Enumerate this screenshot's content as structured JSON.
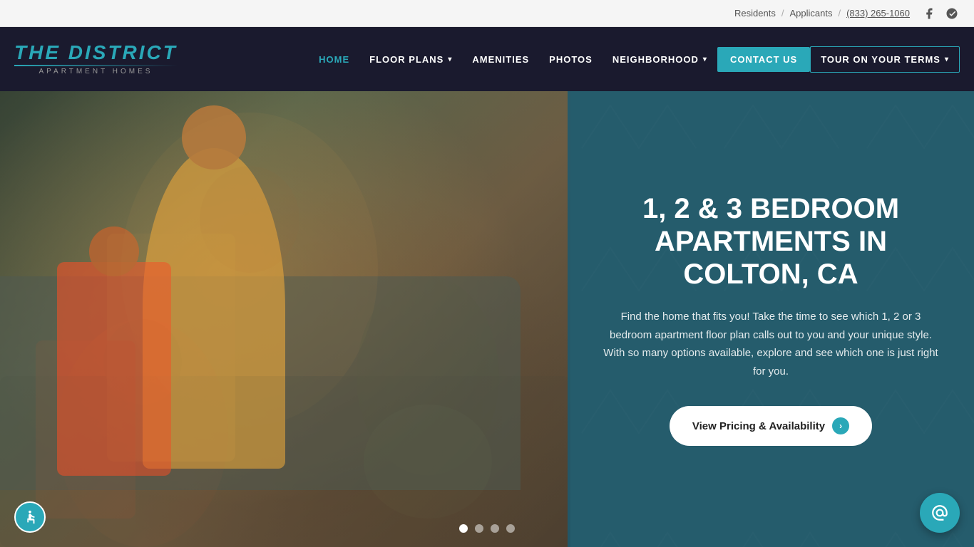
{
  "topbar": {
    "residents_label": "Residents",
    "separator1": "/",
    "applicants_label": "Applicants",
    "separator2": "/",
    "phone": "(833) 265-1060"
  },
  "logo": {
    "main": "THE DISTRICT",
    "sub": "APARTMENT HOMES"
  },
  "nav": {
    "home": "HOME",
    "floor_plans": "FLOOR PLANS",
    "amenities": "AMENITIES",
    "photos": "PHOTOS",
    "neighborhood": "NEIGHBORHOOD",
    "contact_us": "CONTACT US",
    "tour": "TOUR ON YOUR TERMS"
  },
  "hero": {
    "title": "1, 2 & 3 BEDROOM APARTMENTS IN COLTON, CA",
    "description": "Find the home that fits you! Take the time to see which 1, 2 or 3 bedroom apartment floor plan calls out to you and your unique style. With so many options available, explore and see which one is just right for you.",
    "cta_label": "View Pricing & Availability"
  },
  "dots": {
    "count": 4,
    "active_index": 0
  },
  "colors": {
    "teal": "#2aa8b8",
    "dark_bg": "#1a1a2e",
    "panel_bg": "rgba(30, 90, 110, 0.88)"
  }
}
